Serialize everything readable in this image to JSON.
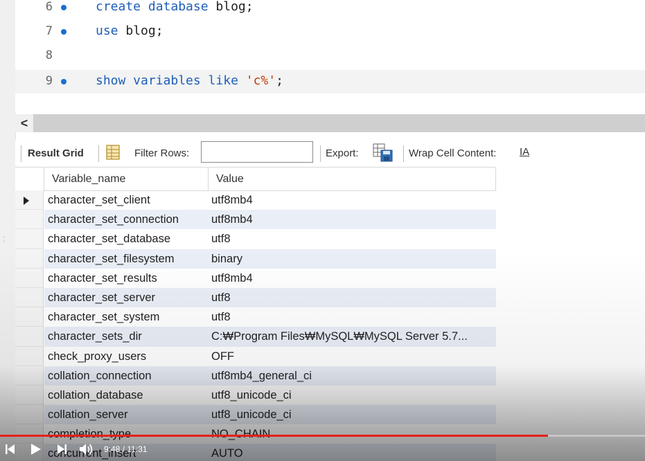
{
  "editor": {
    "lines": [
      {
        "no": "6",
        "bullet": true,
        "parts": [
          {
            "t": "create database ",
            "c": "kw"
          },
          {
            "t": "blog;",
            "c": ""
          }
        ]
      },
      {
        "no": "7",
        "bullet": true,
        "parts": [
          {
            "t": "use ",
            "c": "kw"
          },
          {
            "t": "blog;",
            "c": ""
          }
        ]
      },
      {
        "no": "8",
        "bullet": false,
        "parts": []
      },
      {
        "no": "9",
        "bullet": true,
        "parts": [
          {
            "t": "show variables like ",
            "c": "kw"
          },
          {
            "t": "'c%'",
            "c": "str"
          },
          {
            "t": ";",
            "c": ""
          }
        ]
      }
    ]
  },
  "scrollbar": {
    "left_arrow": "<"
  },
  "toolbar": {
    "result_grid": "Result Grid",
    "filter_rows": "Filter Rows:",
    "filter_value": "",
    "export": "Export:",
    "wrap_cell": "Wrap Cell Content:",
    "wrap_icon_text": "IA"
  },
  "grid": {
    "columns": [
      "Variable_name",
      "Value"
    ],
    "rows": [
      {
        "name": "character_set_client",
        "value": "utf8mb4"
      },
      {
        "name": "character_set_connection",
        "value": "utf8mb4"
      },
      {
        "name": "character_set_database",
        "value": "utf8"
      },
      {
        "name": "character_set_filesystem",
        "value": "binary"
      },
      {
        "name": "character_set_results",
        "value": "utf8mb4"
      },
      {
        "name": "character_set_server",
        "value": "utf8"
      },
      {
        "name": "character_set_system",
        "value": "utf8"
      },
      {
        "name": "character_sets_dir",
        "value": "C:₩Program Files₩MySQL₩MySQL Server 5.7..."
      },
      {
        "name": "check_proxy_users",
        "value": "OFF"
      },
      {
        "name": "collation_connection",
        "value": "utf8mb4_general_ci"
      },
      {
        "name": "collation_database",
        "value": "utf8_unicode_ci"
      },
      {
        "name": "collation_server",
        "value": "utf8_unicode_ci"
      },
      {
        "name": "completion_type",
        "value": "NO_CHAIN"
      },
      {
        "name": "concurrent_insert",
        "value": "AUTO"
      }
    ]
  },
  "player": {
    "time": "9:48 / 11:31",
    "progress": 0.85,
    "accent": "#e62117"
  }
}
